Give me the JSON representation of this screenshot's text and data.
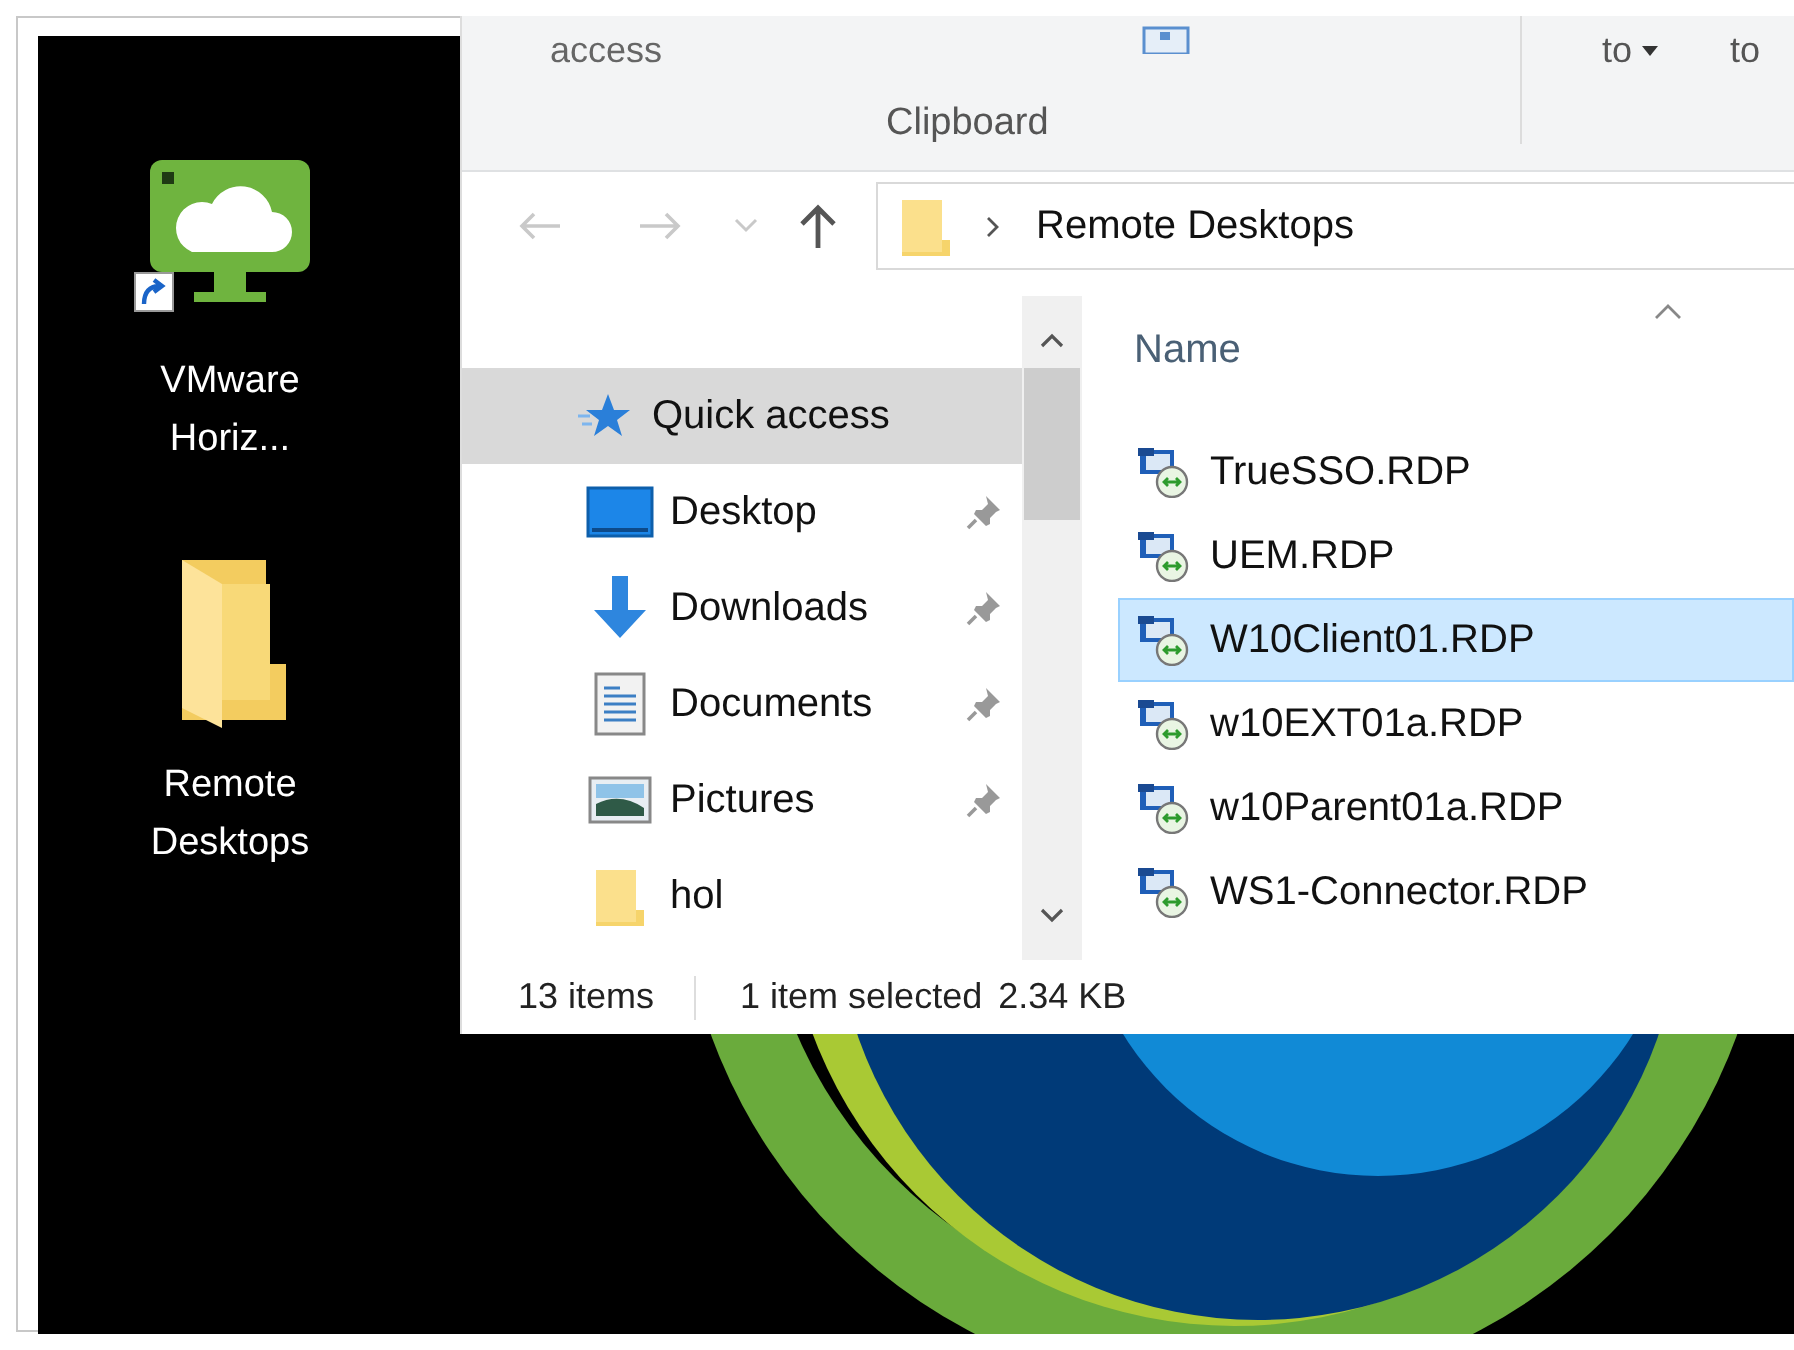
{
  "desktop_icons": [
    {
      "label": "VMware Horiz...",
      "kind": "app",
      "shortcut": true
    },
    {
      "label": "Remote Desktops",
      "kind": "folder",
      "shortcut": false
    }
  ],
  "ribbon": {
    "commands": [
      {
        "label": "access",
        "dropdown": false
      },
      {
        "label": "to",
        "dropdown": true
      },
      {
        "label": "to",
        "dropdown": false
      }
    ],
    "group_label": "Clipboard"
  },
  "address_bar": {
    "path": "Remote Desktops"
  },
  "navigation_pane": {
    "items": [
      {
        "label": "Quick access",
        "kind": "star",
        "selected": true,
        "pinned": false,
        "children": [
          {
            "label": "Desktop",
            "kind": "desktop",
            "selected": false,
            "pinned": true
          },
          {
            "label": "Downloads",
            "kind": "download",
            "selected": false,
            "pinned": true
          },
          {
            "label": "Documents",
            "kind": "document",
            "selected": false,
            "pinned": true
          },
          {
            "label": "Pictures",
            "kind": "picture",
            "selected": false,
            "pinned": true
          },
          {
            "label": "hol",
            "kind": "folder",
            "selected": false,
            "pinned": false
          }
        ]
      }
    ]
  },
  "file_list": {
    "columns": [
      "Name"
    ],
    "files": [
      {
        "name": "TrueSSO.RDP",
        "selected": false
      },
      {
        "name": "UEM.RDP",
        "selected": false
      },
      {
        "name": "W10Client01.RDP",
        "selected": true
      },
      {
        "name": "w10EXT01a.RDP",
        "selected": false
      },
      {
        "name": "w10Parent01a.RDP",
        "selected": false
      },
      {
        "name": "WS1-Connector.RDP",
        "selected": false
      }
    ]
  },
  "status_bar": {
    "item_count": "13 items",
    "selection": "1 item selected",
    "size": "2.34 KB"
  }
}
